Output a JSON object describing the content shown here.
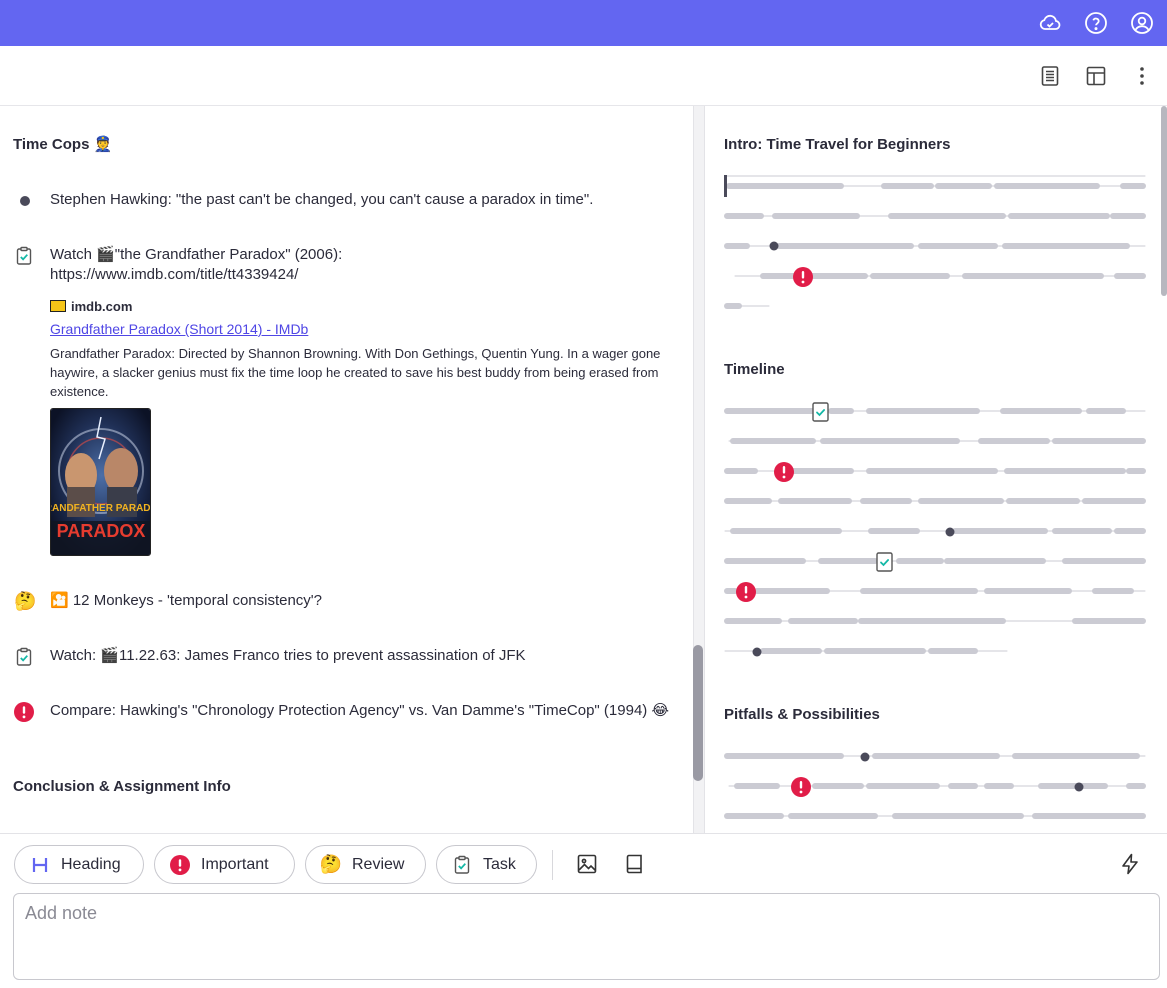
{
  "colors": {
    "accent": "#6366f1",
    "important": "#e11d48",
    "task": "#14b8a6",
    "link": "#4f46e5",
    "timeline_bar": "#cbcbd3"
  },
  "topbar": {
    "icons": [
      "cloud-check-icon",
      "help-icon",
      "account-icon"
    ]
  },
  "toolbar": {
    "icons": [
      "document-view-icon",
      "layout-icon",
      "more-vert-icon"
    ]
  },
  "notes": {
    "heading1": "Time Cops 👮",
    "item1": "Stephen Hawking: \"the past can't be changed, you can't cause a paradox in time\".",
    "item2_line1": "Watch 🎬\"the Grandfather Paradox\" (2006):",
    "item2_line2": "https://www.imdb.com/title/tt4339424/",
    "link_site": "imdb.com",
    "link_title": "Grandfather Paradox (Short 2014) - IMDb",
    "link_desc": "Grandfather Paradox: Directed by Shannon Browning. With Don Gethings, Quentin Yung. In a wager gone haywire, a slacker genius must fix the time loop he created to save his best buddy from being erased from existence.",
    "poster_text": "GRANDFATHER PARADOX",
    "item3": "🎦 12 Monkeys - 'temporal consistency'?",
    "item4": "Watch: 🎬11.22.63: James Franco tries to prevent assassination of JFK",
    "item5": "Compare: Hawking's \"Chronology Protection Agency\" vs. Van Damme's \"TimeCop\" (1994) 😂",
    "heading2": "Conclusion & Assignment Info"
  },
  "outline": {
    "sections": [
      "Intro: Time Travel for Beginners",
      "Timeline",
      "Pitfalls & Possibilities"
    ]
  },
  "composer": {
    "chips": {
      "heading": "Heading",
      "important": "Important",
      "review": "Review",
      "task": "Task"
    },
    "placeholder": "Add note"
  }
}
